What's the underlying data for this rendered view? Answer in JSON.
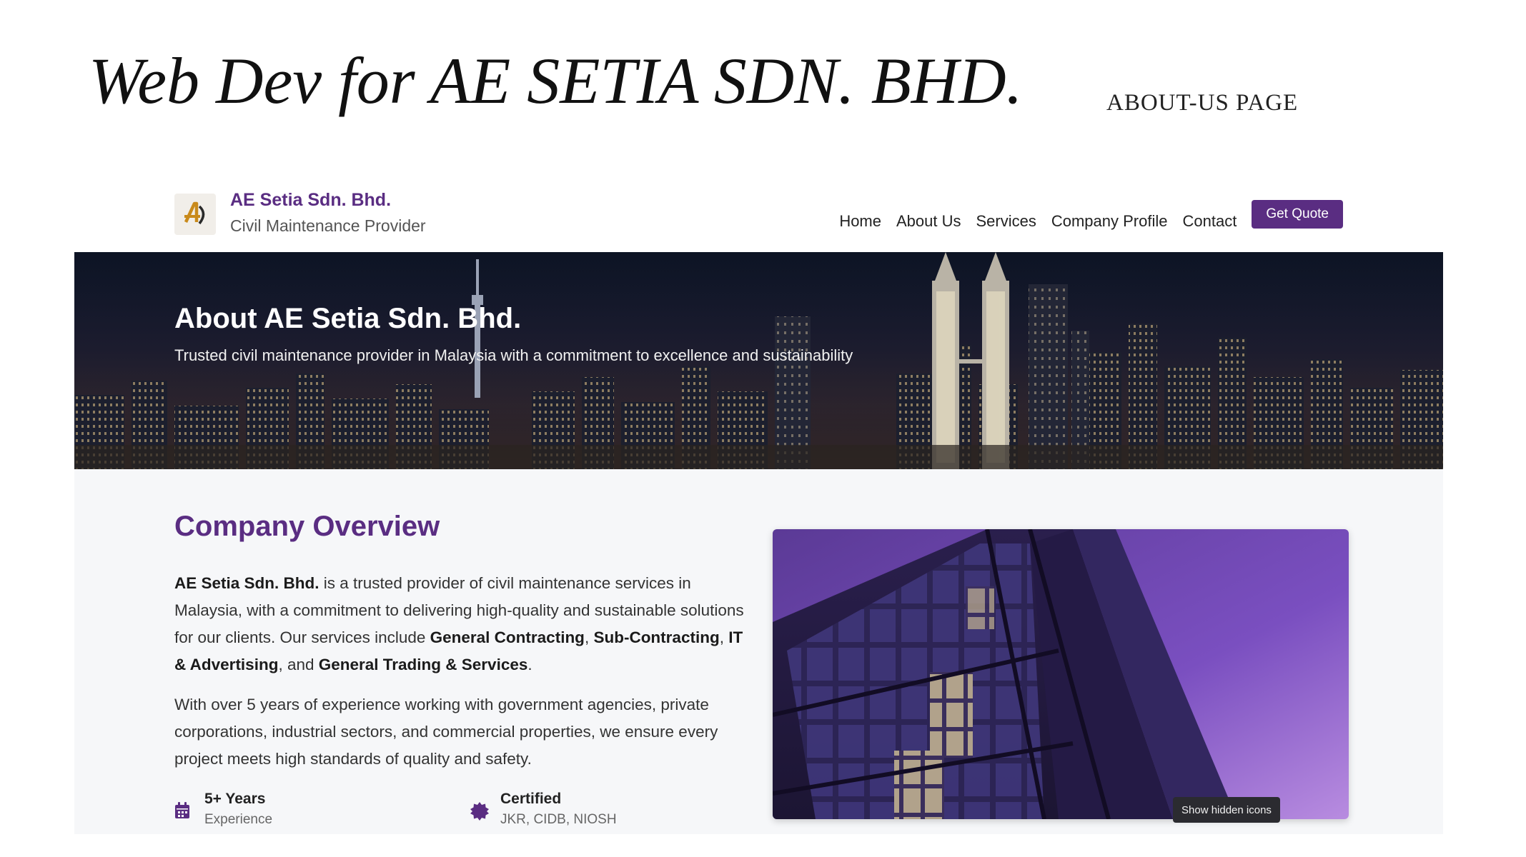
{
  "slide": {
    "title": "Web Dev for AE SETIA SDN. BHD.",
    "subtitle": "ABOUT-US PAGE"
  },
  "header": {
    "logo_icon": "company-logo",
    "brand_name": "AE Setia Sdn. Bhd.",
    "brand_tagline": "Civil Maintenance Provider",
    "nav": [
      "Home",
      "About Us",
      "Services",
      "Company Profile",
      "Contact"
    ],
    "cta_label": "Get Quote",
    "accent_color": "#5a2d82"
  },
  "hero": {
    "title": "About AE Setia Sdn. Bhd.",
    "subtitle": "Trusted civil maintenance provider in Malaysia with a commitment to excellence and sustainability"
  },
  "overview": {
    "title": "Company Overview",
    "p1": {
      "t1": "AE Setia Sdn. Bhd.",
      "t2": " is a trusted provider of civil maintenance services in Malaysia, with a commitment to delivering high-quality and sustainable solutions for our clients. Our services include ",
      "t3": "General Contracting",
      "t4": ", ",
      "t5": "Sub-Contracting",
      "t6": ", ",
      "t7": "IT & Advertising",
      "t8": ", and ",
      "t9": "General Trading & Services",
      "t10": "."
    },
    "p2": "With over 5 years of experience working with government agencies, private corporations, industrial sectors, and commercial properties, we ensure every project meets high standards of quality and safety.",
    "stats": [
      {
        "icon": "calendar-icon",
        "title": "5+ Years",
        "sub": "Experience"
      },
      {
        "icon": "certificate-badge-icon",
        "title": "Certified",
        "sub": "JKR, CIDB, NIOSH"
      }
    ]
  },
  "tooltip": "Show hidden icons"
}
